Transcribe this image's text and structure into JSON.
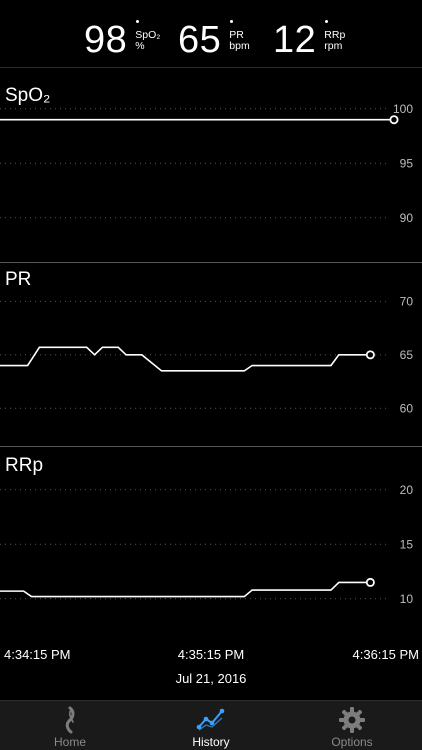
{
  "header": {
    "spo2": {
      "value": "98",
      "label": "SpO₂",
      "unit": "%"
    },
    "pr": {
      "value": "65",
      "label": "PR",
      "unit": "bpm"
    },
    "rrp": {
      "value": "12",
      "label": "RRp",
      "unit": "rpm"
    }
  },
  "charts": {
    "spo2": {
      "title": "SpO₂",
      "ticks": [
        "100",
        "95",
        "90"
      ],
      "tick_values": [
        100,
        95,
        90
      ],
      "ylim": [
        87.5,
        102
      ],
      "points": [
        [
          0,
          99
        ],
        [
          1,
          99
        ]
      ]
    },
    "pr": {
      "title": "PR",
      "ticks": [
        "70",
        "65",
        "60"
      ],
      "tick_values": [
        70,
        65,
        60
      ],
      "ylim": [
        57.5,
        72
      ],
      "points": [
        [
          0,
          64
        ],
        [
          0.07,
          64
        ],
        [
          0.1,
          65.7
        ],
        [
          0.22,
          65.7
        ],
        [
          0.24,
          65
        ],
        [
          0.26,
          65.7
        ],
        [
          0.3,
          65.7
        ],
        [
          0.32,
          65
        ],
        [
          0.36,
          65
        ],
        [
          0.41,
          63.5
        ],
        [
          0.62,
          63.5
        ],
        [
          0.64,
          64
        ],
        [
          0.84,
          64
        ],
        [
          0.86,
          65
        ],
        [
          0.94,
          65
        ]
      ]
    },
    "rrp": {
      "title": "RRp",
      "ticks": [
        "20",
        "15",
        "10"
      ],
      "tick_values": [
        20,
        15,
        10
      ],
      "ylim": [
        7.5,
        22
      ],
      "points": [
        [
          0,
          10.7
        ],
        [
          0.06,
          10.7
        ],
        [
          0.08,
          10.2
        ],
        [
          0.62,
          10.2
        ],
        [
          0.64,
          10.8
        ],
        [
          0.84,
          10.8
        ],
        [
          0.86,
          11.5
        ],
        [
          0.94,
          11.5
        ]
      ]
    }
  },
  "time_axis": {
    "start": "4:34:15 PM",
    "mid": "4:35:15 PM",
    "end": "4:36:15 PM",
    "date": "Jul 21, 2016"
  },
  "tabs": [
    {
      "label": "Home",
      "icon": "home-icon"
    },
    {
      "label": "History",
      "icon": "history-icon",
      "active": true
    },
    {
      "label": "Options",
      "icon": "gear-icon"
    }
  ],
  "colors": {
    "background": "#000000",
    "line": "#ffffff",
    "grid": "#555555",
    "accent": "#3aa0ff",
    "tabbar": "#1a1a1a"
  }
}
